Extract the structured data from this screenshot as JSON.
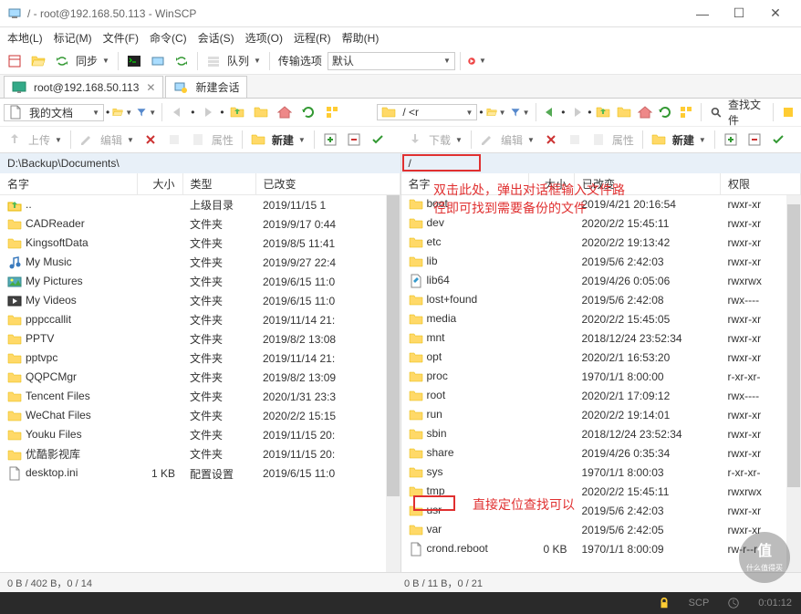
{
  "window": {
    "title": "/ - root@192.168.50.113 - WinSCP"
  },
  "menu": {
    "items": [
      "本地(L)",
      "标记(M)",
      "文件(F)",
      "命令(C)",
      "会话(S)",
      "选项(O)",
      "远程(R)",
      "帮助(H)"
    ]
  },
  "toolbar1": {
    "sync": "同步",
    "queue": "队列",
    "transfer_label": "传输选项",
    "transfer_value": "默认"
  },
  "tabs": {
    "active": "root@192.168.50.113",
    "new": "新建会话"
  },
  "leftNav": {
    "location": "我的文档"
  },
  "rightNav": {
    "location": "/ <r"
  },
  "searchLabel": "查找文件",
  "leftActions": {
    "upload": "上传",
    "edit": "编辑",
    "props": "属性",
    "newdir": "新建"
  },
  "rightActions": {
    "download": "下载",
    "edit": "编辑",
    "props": "属性",
    "newdir": "新建"
  },
  "leftPath": "D:\\Backup\\Documents\\",
  "rightPath": "/",
  "columns": {
    "name": "名字",
    "size": "大小",
    "type": "类型",
    "changed": "已改变",
    "rights": "权限"
  },
  "leftFiles": [
    {
      "name": "..",
      "icon": "up",
      "size": "",
      "type": "上级目录",
      "changed": "2019/11/15 1"
    },
    {
      "name": "CADReader",
      "icon": "folder",
      "size": "",
      "type": "文件夹",
      "changed": "2019/9/17 0:44"
    },
    {
      "name": "KingsoftData",
      "icon": "folder",
      "size": "",
      "type": "文件夹",
      "changed": "2019/8/5 11:41"
    },
    {
      "name": "My Music",
      "icon": "music",
      "size": "",
      "type": "文件夹",
      "changed": "2019/9/27 22:4"
    },
    {
      "name": "My Pictures",
      "icon": "picture",
      "size": "",
      "type": "文件夹",
      "changed": "2019/6/15 11:0"
    },
    {
      "name": "My Videos",
      "icon": "video",
      "size": "",
      "type": "文件夹",
      "changed": "2019/6/15 11:0"
    },
    {
      "name": "pppccallit",
      "icon": "folder",
      "size": "",
      "type": "文件夹",
      "changed": "2019/11/14 21:"
    },
    {
      "name": "PPTV",
      "icon": "folder",
      "size": "",
      "type": "文件夹",
      "changed": "2019/8/2 13:08"
    },
    {
      "name": "pptvpc",
      "icon": "folder",
      "size": "",
      "type": "文件夹",
      "changed": "2019/11/14 21:"
    },
    {
      "name": "QQPCMgr",
      "icon": "folder",
      "size": "",
      "type": "文件夹",
      "changed": "2019/8/2 13:09"
    },
    {
      "name": "Tencent Files",
      "icon": "folder",
      "size": "",
      "type": "文件夹",
      "changed": "2020/1/31 23:3"
    },
    {
      "name": "WeChat Files",
      "icon": "folder",
      "size": "",
      "type": "文件夹",
      "changed": "2020/2/2 15:15"
    },
    {
      "name": "Youku Files",
      "icon": "folder",
      "size": "",
      "type": "文件夹",
      "changed": "2019/11/15 20:"
    },
    {
      "name": "优酷影视库",
      "icon": "folder",
      "size": "",
      "type": "文件夹",
      "changed": "2019/11/15 20:"
    },
    {
      "name": "desktop.ini",
      "icon": "file",
      "size": "1 KB",
      "type": "配置设置",
      "changed": "2019/6/15 11:0"
    }
  ],
  "rightFiles": [
    {
      "name": "boot",
      "icon": "folder",
      "size": "",
      "changed": "2019/4/21 20:16:54",
      "rights": "rwxr-xr"
    },
    {
      "name": "dev",
      "icon": "folder",
      "size": "",
      "changed": "2020/2/2 15:45:11",
      "rights": "rwxr-xr"
    },
    {
      "name": "etc",
      "icon": "folder",
      "size": "",
      "changed": "2020/2/2 19:13:42",
      "rights": "rwxr-xr"
    },
    {
      "name": "lib",
      "icon": "folder",
      "size": "",
      "changed": "2019/5/6 2:42:03",
      "rights": "rwxr-xr"
    },
    {
      "name": "lib64",
      "icon": "link",
      "size": "",
      "changed": "2019/4/26 0:05:06",
      "rights": "rwxrwx"
    },
    {
      "name": "lost+found",
      "icon": "folder",
      "size": "",
      "changed": "2019/5/6 2:42:08",
      "rights": "rwx----"
    },
    {
      "name": "media",
      "icon": "folder",
      "size": "",
      "changed": "2020/2/2 15:45:05",
      "rights": "rwxr-xr"
    },
    {
      "name": "mnt",
      "icon": "folder",
      "size": "",
      "changed": "2018/12/24 23:52:34",
      "rights": "rwxr-xr"
    },
    {
      "name": "opt",
      "icon": "folder",
      "size": "",
      "changed": "2020/2/1 16:53:20",
      "rights": "rwxr-xr"
    },
    {
      "name": "proc",
      "icon": "folder",
      "size": "",
      "changed": "1970/1/1 8:00:00",
      "rights": "r-xr-xr-"
    },
    {
      "name": "root",
      "icon": "folder",
      "size": "",
      "changed": "2020/2/1 17:09:12",
      "rights": "rwx----"
    },
    {
      "name": "run",
      "icon": "folder",
      "size": "",
      "changed": "2020/2/2 19:14:01",
      "rights": "rwxr-xr"
    },
    {
      "name": "sbin",
      "icon": "folder",
      "size": "",
      "changed": "2018/12/24 23:52:34",
      "rights": "rwxr-xr"
    },
    {
      "name": "share",
      "icon": "folder",
      "size": "",
      "changed": "2019/4/26 0:35:34",
      "rights": "rwxr-xr"
    },
    {
      "name": "sys",
      "icon": "folder",
      "size": "",
      "changed": "1970/1/1 8:00:03",
      "rights": "r-xr-xr-"
    },
    {
      "name": "tmp",
      "icon": "folder",
      "size": "",
      "changed": "2020/2/2 15:45:11",
      "rights": "rwxrwx"
    },
    {
      "name": "usr",
      "icon": "folder",
      "size": "",
      "changed": "2019/5/6 2:42:03",
      "rights": "rwxr-xr"
    },
    {
      "name": "var",
      "icon": "folder",
      "size": "",
      "changed": "2019/5/6 2:42:05",
      "rights": "rwxr-xr"
    },
    {
      "name": "crond.reboot",
      "icon": "file",
      "size": "0 KB",
      "changed": "1970/1/1 8:00:09",
      "rights": "rw-r--r"
    }
  ],
  "status": {
    "left": "0 B / 402 B，0 / 14",
    "right": "0 B / 11 B，0 / 21"
  },
  "bottom": {
    "protocol": "SCP",
    "time": "0:01:12"
  },
  "annotations": {
    "a1_line1": "双击此处，弹出对话框输入文件路",
    "a1_line2": "径即可找到需要备份的文件",
    "a2": "直接定位查找可以"
  },
  "watermark": "什么值得买"
}
